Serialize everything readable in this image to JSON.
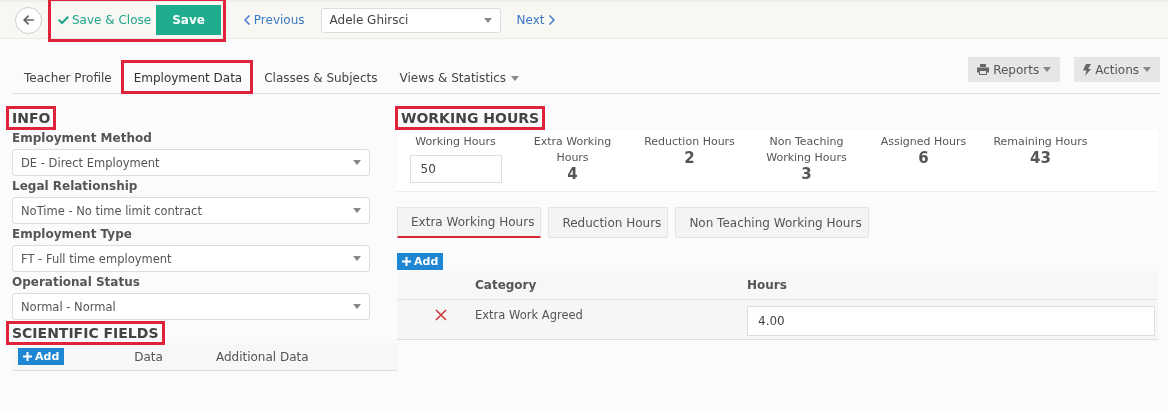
{
  "toolbar": {
    "save_close": "Save & Close",
    "save": "Save",
    "highlighted": true,
    "previous": "Previous",
    "teacher_select": "Adele Ghirsci",
    "next": "Next"
  },
  "tabs": [
    {
      "label": "Teacher Profile",
      "selected": false,
      "highlighted": false,
      "dropdown": false
    },
    {
      "label": "Employment Data",
      "selected": true,
      "highlighted": true,
      "dropdown": false
    },
    {
      "label": "Classes & Subjects",
      "selected": false,
      "highlighted": false,
      "dropdown": false
    },
    {
      "label": "Views & Statistics",
      "selected": false,
      "highlighted": false,
      "dropdown": true
    }
  ],
  "tab_actions": [
    {
      "label": "Reports",
      "kind": "print"
    },
    {
      "label": "Actions",
      "kind": "bolt"
    }
  ],
  "info": {
    "title": "INFO",
    "highlighted": true,
    "fields": [
      {
        "label": "Employment Method",
        "value": "DE - Direct Employment"
      },
      {
        "label": "Legal Relationship",
        "value": "NoTime - No time limit contract"
      },
      {
        "label": "Employment Type",
        "value": "FT - Full time employment"
      },
      {
        "label": "Operational Status",
        "value": "Normal - Normal"
      }
    ]
  },
  "scientific_fields": {
    "title": "SCIENTIFIC FIELDS",
    "highlighted": true,
    "add": "Add",
    "columns": [
      "Data",
      "Additional Data"
    ]
  },
  "working_hours": {
    "title": "WORKING HOURS",
    "highlighted": true,
    "stats": [
      {
        "label": "Working Hours",
        "kind": "input",
        "value": "50"
      },
      {
        "label": "Extra Working Hours",
        "kind": "value",
        "value": "4"
      },
      {
        "label": "Reduction Hours",
        "kind": "value",
        "value": "2"
      },
      {
        "label": "Non Teaching Working Hours",
        "kind": "value",
        "value": "3"
      },
      {
        "label": "Assigned Hours",
        "kind": "value",
        "value": "6"
      },
      {
        "label": "Remaining Hours",
        "kind": "value",
        "value": "43"
      }
    ],
    "subtabs": [
      {
        "label": "Extra Working Hours",
        "selected": true
      },
      {
        "label": "Reduction Hours",
        "selected": false
      },
      {
        "label": "Non Teaching Working Hours",
        "selected": false
      }
    ],
    "add": "Add",
    "table": {
      "columns": [
        "Category",
        "Hours"
      ],
      "rows": [
        {
          "category": "Extra Work Agreed",
          "hours": "4.00"
        }
      ]
    }
  }
}
